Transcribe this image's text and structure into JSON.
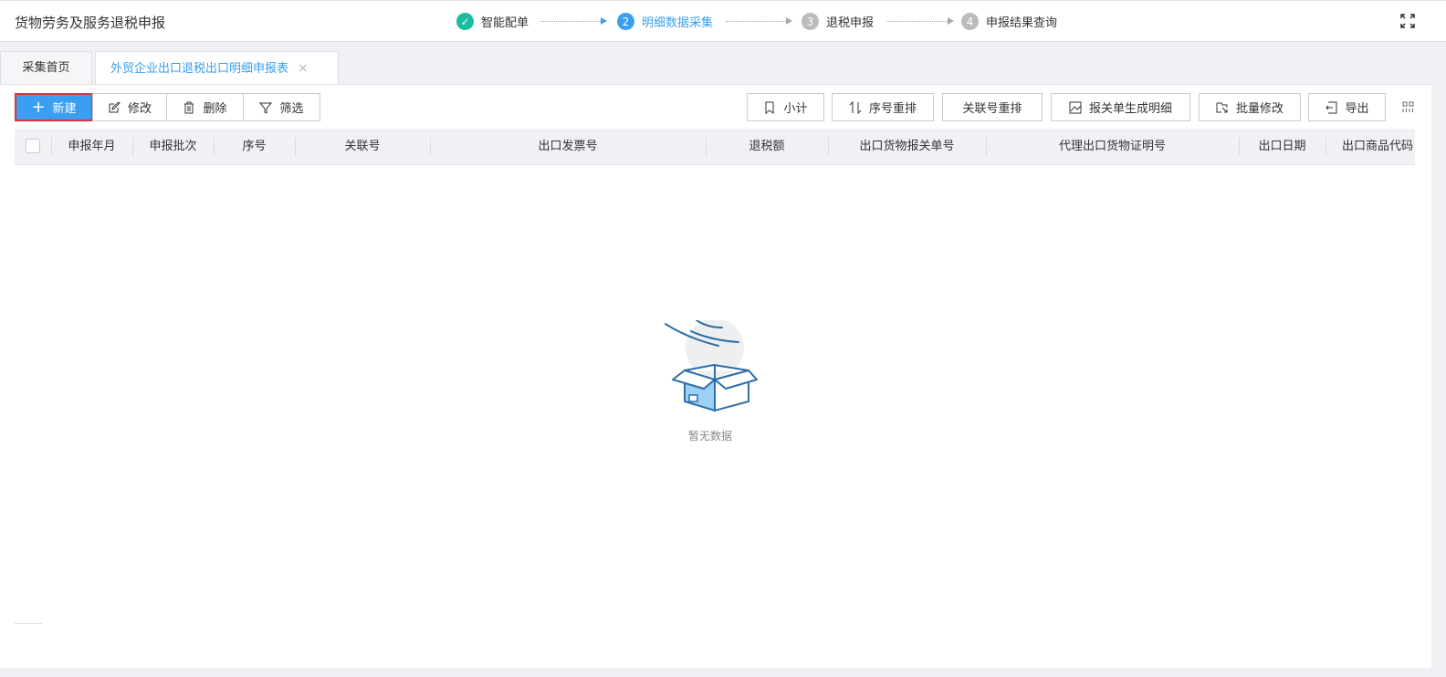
{
  "header": {
    "title": "货物劳务及服务退税申报",
    "steps": [
      {
        "num": "✓",
        "label": "智能配单",
        "state": "done",
        "color": "#1abc9c"
      },
      {
        "num": "2",
        "label": "明细数据采集",
        "state": "active",
        "color": "#3a9ff0"
      },
      {
        "num": "3",
        "label": "退税申报",
        "state": "pending",
        "color": "#bbbbbb"
      },
      {
        "num": "4",
        "label": "申报结果查询",
        "state": "pending",
        "color": "#bbbbbb"
      }
    ],
    "fullscreen_icon": "fullscreen-icon"
  },
  "tabs": [
    {
      "label": "采集首页",
      "active": false
    },
    {
      "label": "外贸企业出口退税出口明细申报表",
      "active": true,
      "close": "×"
    }
  ],
  "toolbar": {
    "left": [
      {
        "label": "新建",
        "icon": "plus-icon"
      },
      {
        "label": "修改",
        "icon": "edit-icon"
      },
      {
        "label": "删除",
        "icon": "trash-icon"
      },
      {
        "label": "筛选",
        "icon": "filter-icon"
      }
    ],
    "right": [
      {
        "label": "小计",
        "icon": "bookmark-icon"
      },
      {
        "label": "序号重排",
        "icon": "sort-icon"
      },
      {
        "label": "关联号重排"
      },
      {
        "label": "报关单生成明细",
        "icon": "image-icon"
      },
      {
        "label": "批量修改",
        "icon": "batch-edit-icon"
      },
      {
        "label": "导出",
        "icon": "export-icon"
      }
    ],
    "column_settings_icon": "columns-icon"
  },
  "table": {
    "columns": [
      "申报年月",
      "申报批次",
      "序号",
      "关联号",
      "出口发票号",
      "退税额",
      "出口货物报关单号",
      "代理出口货物证明号",
      "出口日期",
      "出口商品代码"
    ],
    "empty_text": "暂无数据"
  },
  "colors": {
    "accent": "#3a9ff0",
    "highlight_border": "#e0323a"
  }
}
